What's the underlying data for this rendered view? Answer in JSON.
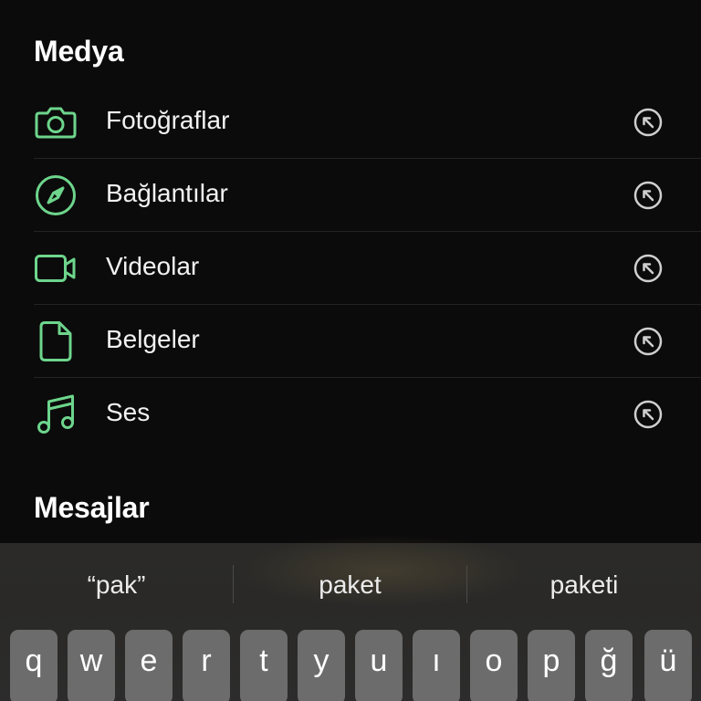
{
  "sections": {
    "media_title": "Medya",
    "messages_title": "Mesajlar"
  },
  "media_items": [
    {
      "label": "Fotoğraflar",
      "icon": "camera-icon"
    },
    {
      "label": "Bağlantılar",
      "icon": "compass-icon"
    },
    {
      "label": "Videolar",
      "icon": "video-camera-icon"
    },
    {
      "label": "Belgeler",
      "icon": "document-icon"
    },
    {
      "label": "Ses",
      "icon": "music-note-icon"
    }
  ],
  "row_action_icon": "arrow-up-left-circle-icon",
  "colors": {
    "accent_green": "#6dd58c",
    "background": "#0b0b0b",
    "keyboard_bg": "#2b2a28",
    "key_bg": "#6c6c6c"
  },
  "keyboard": {
    "suggestions": [
      "“pak”",
      "paket",
      "paketi"
    ],
    "keys": [
      "q",
      "w",
      "e",
      "r",
      "t",
      "y",
      "u",
      "ı",
      "o",
      "p",
      "ğ",
      "ü"
    ]
  }
}
